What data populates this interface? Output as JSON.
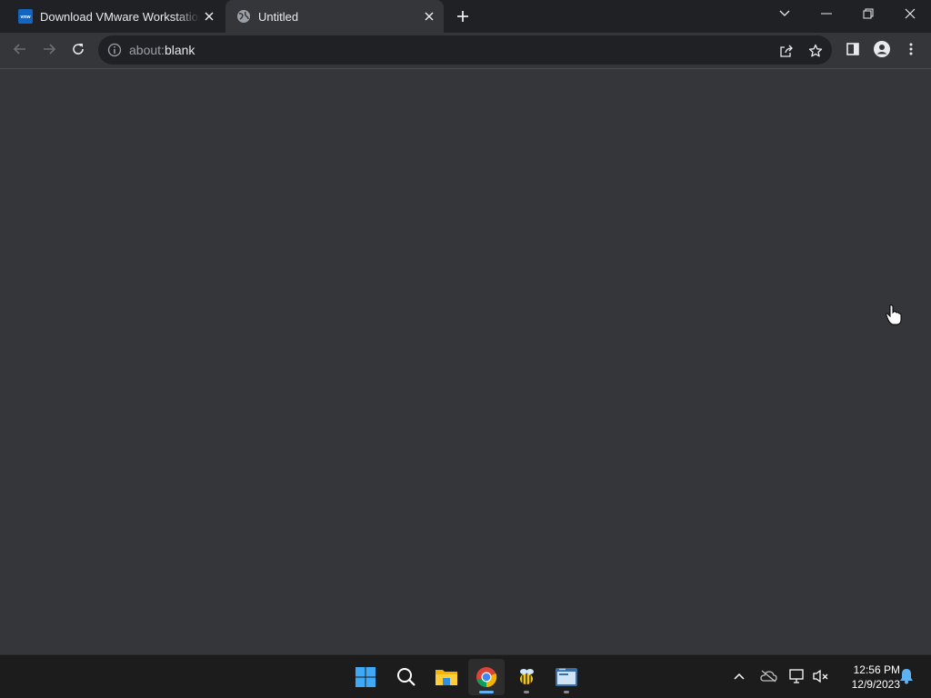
{
  "tabs": [
    {
      "title": "Download VMware Workstation Player | VMware",
      "favicon": "vmware-logo",
      "active": false
    },
    {
      "title": "Untitled",
      "favicon": "globe-icon",
      "active": true
    }
  ],
  "omnibox": {
    "scheme": "about:",
    "host": "blank"
  },
  "taskbar": {
    "apps": [
      "start-icon",
      "search-icon",
      "file-explorer-icon",
      "chrome-icon",
      "app-bee-icon",
      "app-terminal-icon"
    ],
    "active_app": "chrome-icon"
  },
  "clock": {
    "time": "12:56 PM",
    "date": "12/9/2023"
  },
  "colors": {
    "tabstrip": "#202124",
    "toolbar": "#35363a",
    "omnibox": "#202124",
    "taskbar": "#1c1c1c",
    "accent": "#5fb2f2"
  }
}
